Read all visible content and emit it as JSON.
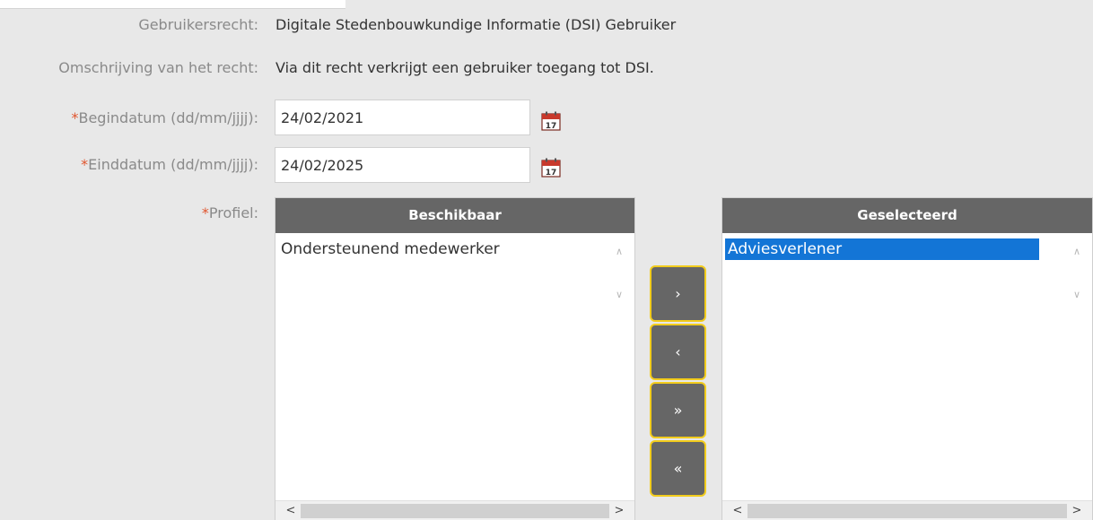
{
  "form": {
    "right_label": "Gebruikersrecht:",
    "right_value": "Digitale Stedenbouwkundige Informatie (DSI) Gebruiker",
    "description_label": "Omschrijving van het recht:",
    "description_value": "Via dit recht verkrijgt een gebruiker toegang tot DSI.",
    "required_marker": "*",
    "start_date_label": "Begindatum (dd/mm/jjjj):",
    "start_date_value": "24/02/2021",
    "end_date_label": "Einddatum (dd/mm/jjjj):",
    "end_date_value": "24/02/2025",
    "profile_label": "Profiel:",
    "calendar_day": "17"
  },
  "available": {
    "header": "Beschikbaar",
    "items": [
      "Ondersteunend medewerker"
    ]
  },
  "selected": {
    "header": "Geselecteerd",
    "items": [
      "Adviesverlener"
    ]
  },
  "buttons": {
    "move_right": "›",
    "move_left": "‹",
    "move_all_right": "»",
    "move_all_left": "«"
  },
  "scroll": {
    "up": "∧",
    "down": "∨",
    "left": "<",
    "right": ">"
  },
  "colors": {
    "required": "#e0552e",
    "header": "#666666",
    "selection": "#1375d6",
    "button_border": "#f2cc1c"
  }
}
